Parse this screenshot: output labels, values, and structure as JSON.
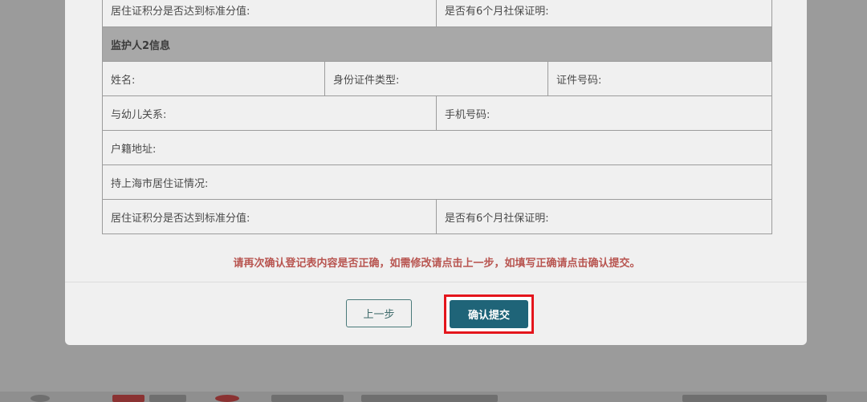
{
  "top_row": {
    "cell1": "居住证积分是否达到标准分值:",
    "cell2": "是否有6个月社保证明:"
  },
  "guardian2": {
    "section_title": "监护人2信息",
    "name": "姓名:",
    "id_type": "身份证件类型:",
    "id_number": "证件号码:",
    "relation": "与幼儿关系:",
    "phone": "手机号码:",
    "address": "户籍地址:",
    "residence_permit": "持上海市居住证情况:",
    "score": "居住证积分是否达到标准分值:",
    "social_security": "是否有6个月社保证明:"
  },
  "notice": "请再次确认登记表内容是否正确，如需修改请点击上一步，如填写正确请点击确认提交。",
  "buttons": {
    "prev": "上一步",
    "confirm": "确认提交"
  },
  "colors": {
    "confirm_bg": "#1f6478",
    "highlight": "#e4151c",
    "notice": "#b85550"
  }
}
